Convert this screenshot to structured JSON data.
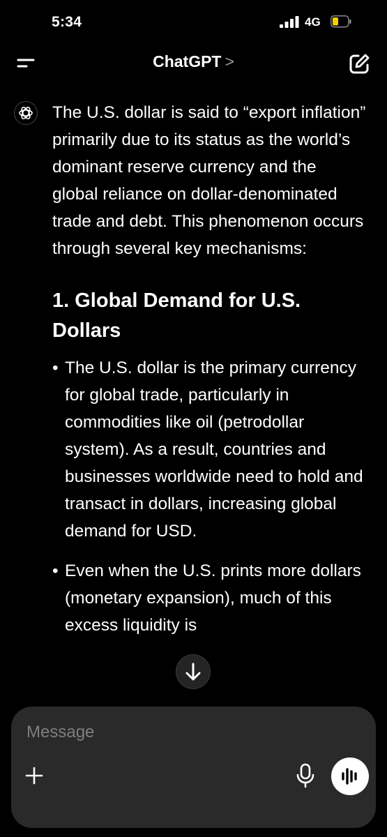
{
  "status_bar": {
    "time": "5:34",
    "network": "4G",
    "battery_color": "#f5d000"
  },
  "header": {
    "title": "ChatGPT",
    "title_chevron": ">",
    "menu_icon": "hamburger-menu-icon",
    "compose_icon": "new-chat-pencil-icon"
  },
  "message": {
    "avatar_icon": "openai-logo-icon",
    "intro": "The U.S. dollar is said to “export inflation” primarily due to its status as the world’s dominant reserve currency and the global reliance on dollar-denominated trade and debt. This phenomenon occurs through several key mechanisms:",
    "section_heading": "1. Global Demand for U.S. Dollars",
    "bullets": [
      "The U.S. dollar is the primary currency for global trade, particularly in commodities like oil (petrodollar system). As a result, countries and businesses worldwide need to hold and transact in dollars, increasing global demand for USD.",
      "Even when the U.S. prints more dollars (monetary expansion), much of this excess liquidity is"
    ],
    "bullet_glyph": "•"
  },
  "scroll_down_icon": "arrow-down-icon",
  "composer": {
    "placeholder": "Message",
    "plus_icon": "plus-icon",
    "mic_icon": "microphone-icon",
    "voice_icon": "voice-waveform-icon"
  }
}
